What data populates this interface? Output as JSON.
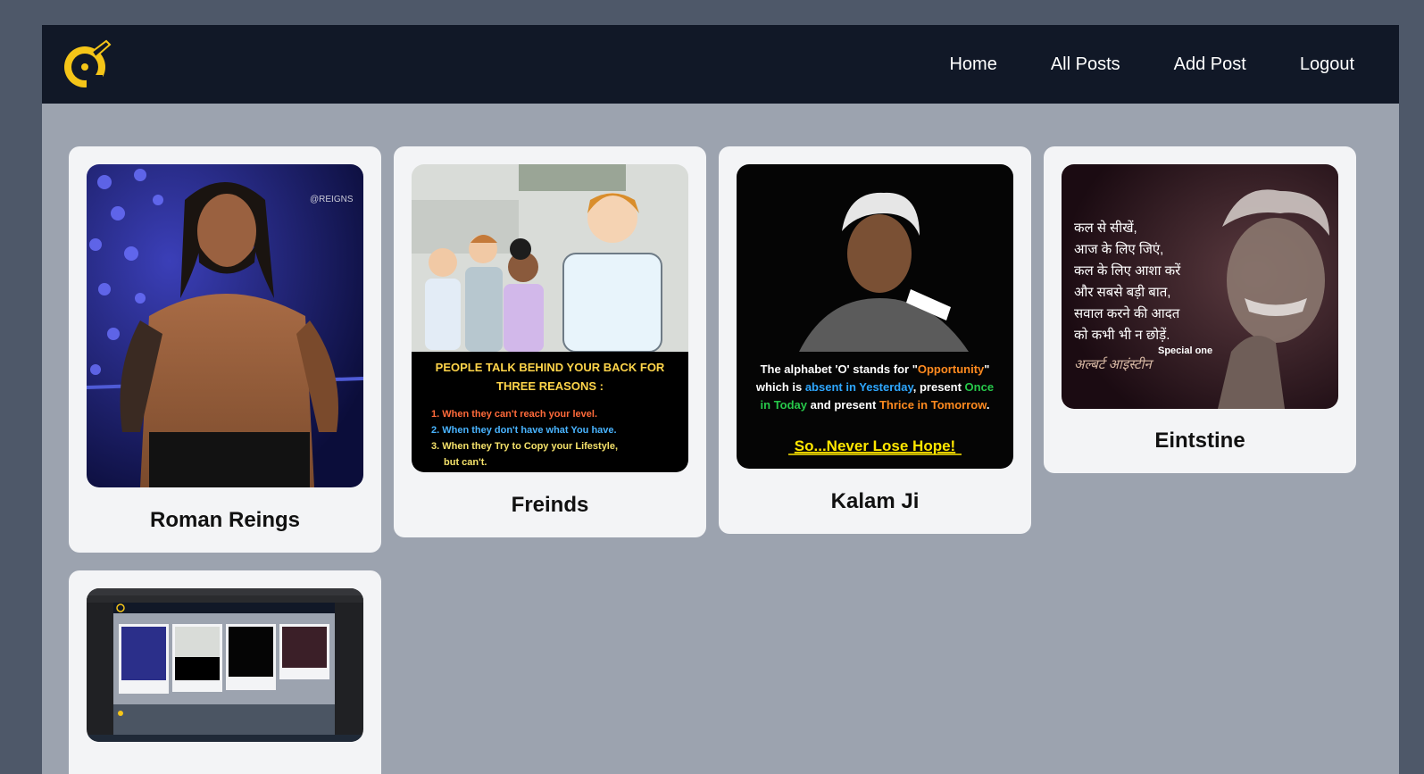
{
  "nav": {
    "links": [
      "Home",
      "All Posts",
      "Add Post",
      "Logout"
    ]
  },
  "posts": [
    {
      "title": "Roman Reings",
      "image_alt": "wrestler-photo"
    },
    {
      "title": "Freinds",
      "image_alt": "friends-cartoon"
    },
    {
      "title": "Kalam Ji",
      "image_alt": "kalam-quote"
    },
    {
      "title": "Eintstine",
      "image_alt": "einstein-quote"
    },
    {
      "title": "",
      "image_alt": "screenshot-thumbnail"
    }
  ],
  "freinds_image_text": {
    "heading_line1": "PEOPLE TALK BEHIND YOUR BACK FOR",
    "heading_line2": "THREE REASONS :",
    "reason1": "1. When they can't reach your level.",
    "reason2": "2. When they don't have what You have.",
    "reason3a": "3. When they Try to Copy your Lifestyle,",
    "reason3b": "but can't."
  },
  "kalam_image_text": {
    "line1_a": "The alphabet 'O' stands for \"",
    "line1_b": "Opportunity",
    "line1_c": "\"",
    "line2_a": "which is ",
    "line2_b": "absent in Yesterday",
    "line2_c": ", present ",
    "line2_d": "Once",
    "line3_a": "in Today",
    "line3_b": " and present ",
    "line3_c": "Thrice in Tomorrow",
    "line3_d": ".",
    "tagline": "So...Never Lose Hope!"
  },
  "einstein_image_text": {
    "lines": [
      "कल से सीखें,",
      "आज के लिए जिएं,",
      "कल के लिए आशा करें",
      "और सबसे बड़ी बात,",
      "सवाल करने की आदत",
      "को कभी भी न छोड़ें."
    ],
    "special": "Special one",
    "signature": "अल्बर्ट आइंस्टीन"
  },
  "colors": {
    "navbar": "#111827",
    "content_bg": "#9ca3af",
    "card_bg": "#f3f4f6",
    "logo_yellow": "#f5c518"
  }
}
